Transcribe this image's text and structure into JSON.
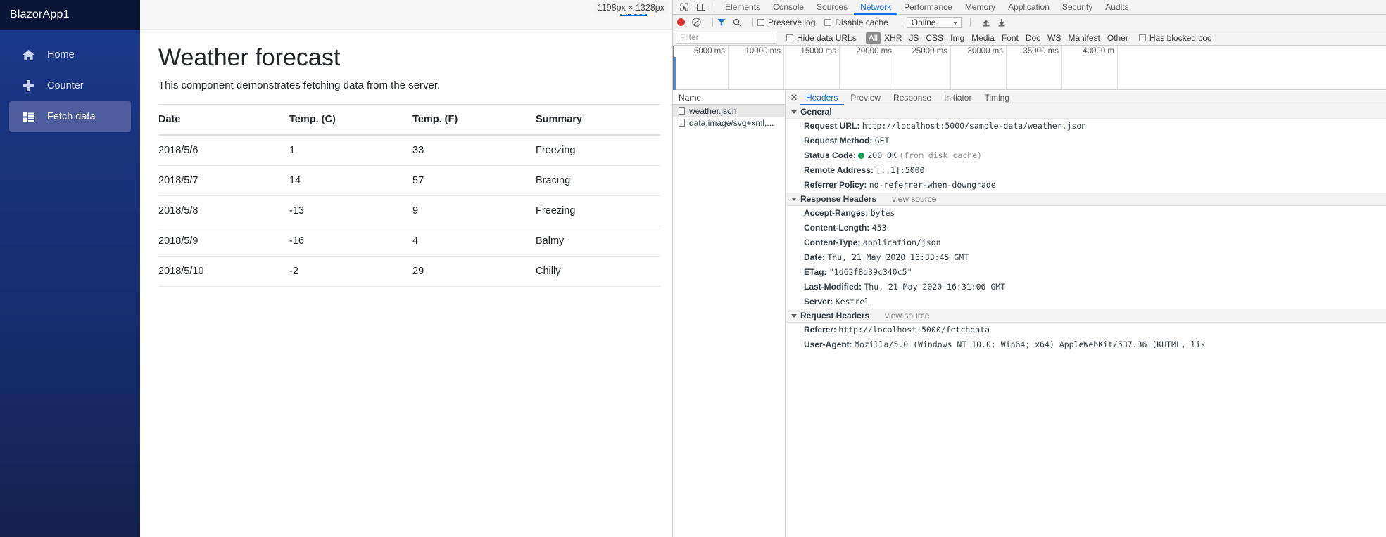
{
  "browser": {
    "viewport_badge": "1198px × 1328px",
    "about_link": "About"
  },
  "sidebar": {
    "brand": "BlazorApp1",
    "items": [
      {
        "label": "Home",
        "icon": "home-icon",
        "active": false
      },
      {
        "label": "Counter",
        "icon": "plus-icon",
        "active": false
      },
      {
        "label": "Fetch data",
        "icon": "list-icon",
        "active": true
      }
    ]
  },
  "page": {
    "title": "Weather forecast",
    "subtitle": "This component demonstrates fetching data from the server.",
    "table": {
      "columns": [
        "Date",
        "Temp. (C)",
        "Temp. (F)",
        "Summary"
      ],
      "rows": [
        [
          "2018/5/6",
          "1",
          "33",
          "Freezing"
        ],
        [
          "2018/5/7",
          "14",
          "57",
          "Bracing"
        ],
        [
          "2018/5/8",
          "-13",
          "9",
          "Freezing"
        ],
        [
          "2018/5/9",
          "-16",
          "4",
          "Balmy"
        ],
        [
          "2018/5/10",
          "-2",
          "29",
          "Chilly"
        ]
      ]
    }
  },
  "devtools": {
    "tabs": [
      {
        "label": "Elements",
        "selected": false
      },
      {
        "label": "Console",
        "selected": false
      },
      {
        "label": "Sources",
        "selected": false
      },
      {
        "label": "Network",
        "selected": true
      },
      {
        "label": "Performance",
        "selected": false
      },
      {
        "label": "Memory",
        "selected": false
      },
      {
        "label": "Application",
        "selected": false
      },
      {
        "label": "Security",
        "selected": false
      },
      {
        "label": "Audits",
        "selected": false
      }
    ],
    "toolbar": {
      "preserve_log": "Preserve log",
      "disable_cache": "Disable cache",
      "throttle": "Online"
    },
    "filterbar": {
      "filter_placeholder": "Filter",
      "hide_data_urls": "Hide data URLs",
      "types": [
        "All",
        "XHR",
        "JS",
        "CSS",
        "Img",
        "Media",
        "Font",
        "Doc",
        "WS",
        "Manifest",
        "Other"
      ],
      "selected_type": "All",
      "has_blocked_cookies": "Has blocked coo"
    },
    "timeline": {
      "ticks": [
        "5000 ms",
        "10000 ms",
        "15000 ms",
        "20000 ms",
        "25000 ms",
        "30000 ms",
        "35000 ms",
        "40000 m"
      ]
    },
    "requests": {
      "column_header": "Name",
      "items": [
        {
          "name": "weather.json",
          "selected": true
        },
        {
          "name": "data:image/svg+xml,...",
          "selected": false
        }
      ]
    },
    "detail": {
      "tabs": [
        {
          "label": "Headers",
          "selected": true
        },
        {
          "label": "Preview",
          "selected": false
        },
        {
          "label": "Response",
          "selected": false
        },
        {
          "label": "Initiator",
          "selected": false
        },
        {
          "label": "Timing",
          "selected": false
        }
      ],
      "general": {
        "title": "General",
        "rows": [
          {
            "key": "Request URL:",
            "value": "http://localhost:5000/sample-data/weather.json",
            "status": false
          },
          {
            "key": "Request Method:",
            "value": "GET",
            "status": false
          },
          {
            "key": "Status Code:",
            "value": "200 OK",
            "suffix": "(from disk cache)",
            "status": true
          },
          {
            "key": "Remote Address:",
            "value": "[::1]:5000",
            "status": false
          },
          {
            "key": "Referrer Policy:",
            "value": "no-referrer-when-downgrade",
            "status": false
          }
        ]
      },
      "response_headers": {
        "title": "Response Headers",
        "view_source": "view source",
        "rows": [
          {
            "key": "Accept-Ranges:",
            "value": "bytes"
          },
          {
            "key": "Content-Length:",
            "value": "453"
          },
          {
            "key": "Content-Type:",
            "value": "application/json"
          },
          {
            "key": "Date:",
            "value": "Thu, 21 May 2020 16:33:45 GMT"
          },
          {
            "key": "ETag:",
            "value": "\"1d62f8d39c340c5\""
          },
          {
            "key": "Last-Modified:",
            "value": "Thu, 21 May 2020 16:31:06 GMT"
          },
          {
            "key": "Server:",
            "value": "Kestrel"
          }
        ]
      },
      "request_headers": {
        "title": "Request Headers",
        "view_source": "view source",
        "rows": [
          {
            "key": "Referer:",
            "value": "http://localhost:5000/fetchdata"
          },
          {
            "key": "User-Agent:",
            "value": "Mozilla/5.0 (Windows NT 10.0; Win64; x64) AppleWebKit/537.36 (KHTML, lik"
          }
        ]
      }
    }
  }
}
